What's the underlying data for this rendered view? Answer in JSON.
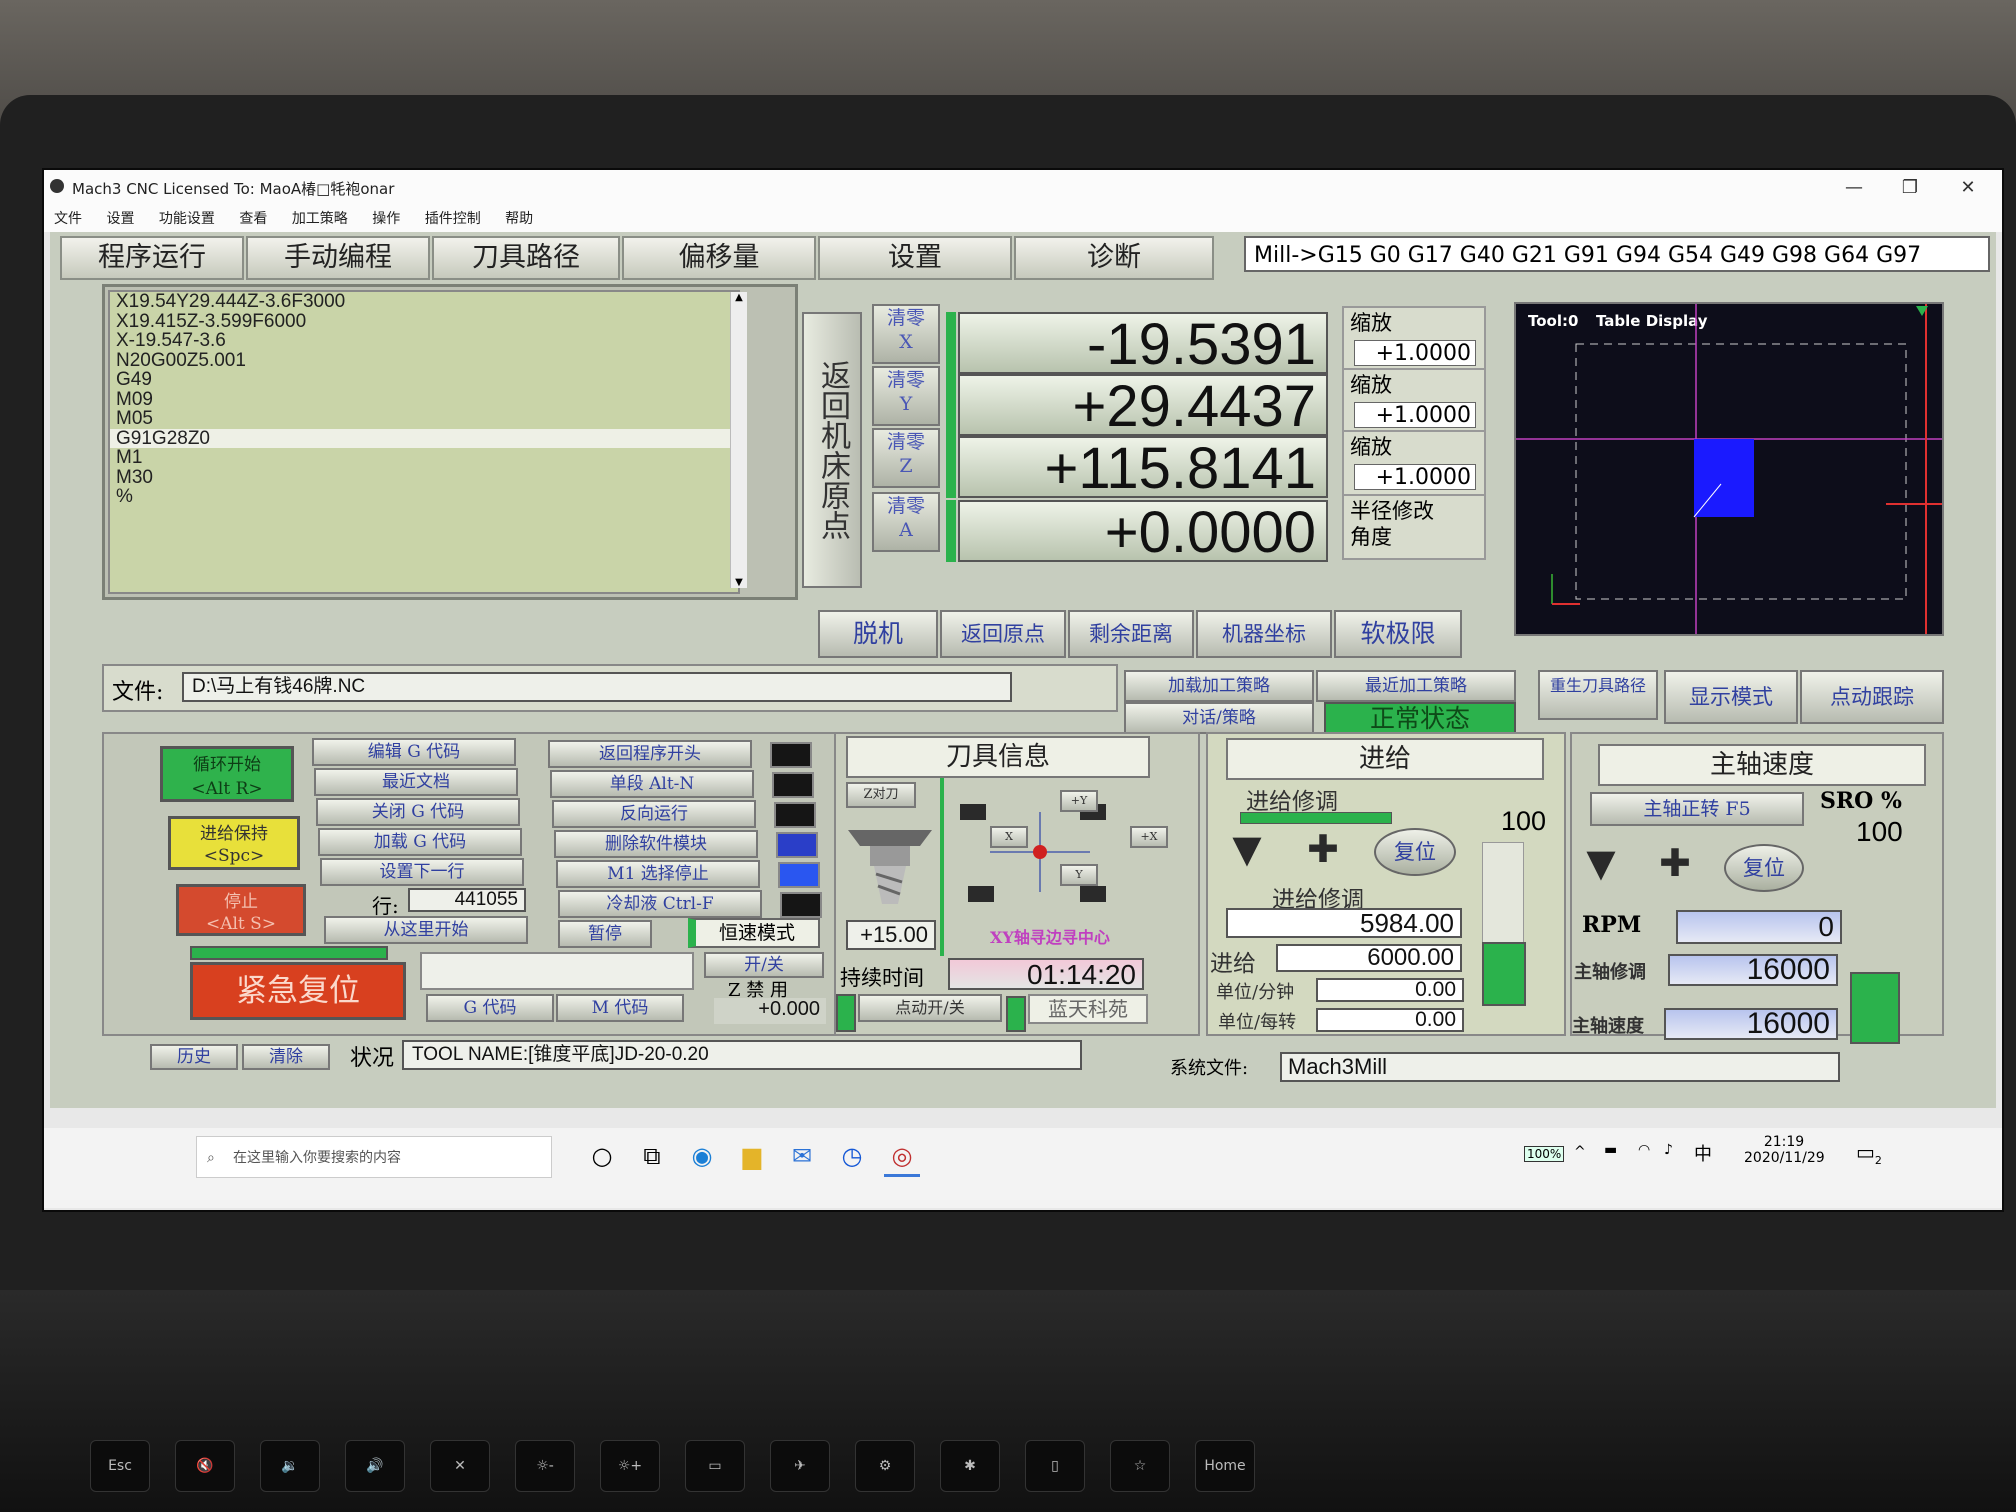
{
  "window": {
    "title": "Mach3 CNC  Licensed To: MaoA椿□牦袍onar",
    "min": "—",
    "restore": "❐",
    "close": "✕"
  },
  "menu": [
    "文件",
    "设置",
    "功能设置",
    "查看",
    "加工策略",
    "操作",
    "插件控制",
    "帮助"
  ],
  "tabs": [
    "程序运行",
    "手动编程",
    "刀具路径",
    "偏移量",
    "设置",
    "诊断"
  ],
  "modal_line": "Mill->G15  G0 G17 G40 G21 G91 G94 G54 G49 G98 G64 G97",
  "gcode": {
    "lines": [
      "X19.54Y29.444Z-3.6F3000",
      "X19.415Z-3.599F6000",
      "X-19.547-3.6",
      "N20G00Z5.001",
      "G49",
      "M09",
      "M05",
      "G91G28Z0",
      "M1",
      "M30",
      "%"
    ],
    "selected_index": 7
  },
  "dro": {
    "ref_all_label": "返回机床原点",
    "axes": [
      {
        "zero": "清零\nX",
        "value": "-19.5391",
        "side_label": "缩放",
        "side_value": "+1.0000"
      },
      {
        "zero": "清零\nY",
        "value": "+29.4437",
        "side_label": "缩放",
        "side_value": "+1.0000"
      },
      {
        "zero": "清零\nZ",
        "value": "+115.8141",
        "side_label": "缩放",
        "side_value": "+1.0000"
      },
      {
        "zero": "清零\nA",
        "value": "+0.0000",
        "side_label": "半径修改\n角度",
        "side_value": ""
      }
    ],
    "buttons": [
      "脱机",
      "返回原点",
      "剩余距离",
      "机器坐标",
      "软极限"
    ]
  },
  "toolpath": {
    "tool": "Tool:0",
    "title": "Table Display"
  },
  "file": {
    "label": "文件:",
    "path": "D:\\马上有钱46牌.NC"
  },
  "strategy": {
    "load": "加载加工策略",
    "recent": "最近加工策略",
    "dialog": "对话/策略",
    "status": "正常状态"
  },
  "right_buttons": [
    "重生刀具路径",
    "显示模式",
    "点动跟踪"
  ],
  "run": {
    "cycle_start": "循环开始\n<Alt R>",
    "feed_hold": "进给保持\n<Spc>",
    "stop": "停止\n<Alt S>",
    "estop": "紧急复位"
  },
  "program_buttons": [
    "编辑 G 代码",
    "最近文档",
    "关闭 G 代码",
    "加载 G 代码",
    "设置下一行"
  ],
  "line": {
    "label": "行:",
    "value": "441055",
    "run_from": "从这里开始"
  },
  "right_program_buttons": [
    "返回程序开头",
    "单段 Alt-N",
    "反向运行",
    "删除软件模块",
    "M1 选择停止",
    "冷却液 Ctrl-F"
  ],
  "pause": "暂停",
  "const_mode": "恒速模式",
  "gcode_btn": "G 代码",
  "mcode_btn": "M 代码",
  "z_inhibit": {
    "on_off": "开/关",
    "label": "Z 禁 用",
    "value": "+0.000"
  },
  "tool_info": {
    "title": "刀具信息",
    "ztouch": "Z对刀",
    "z_value": "+15.00",
    "edge_label": "XY轴寻边寻中心",
    "elapsed_label": "持续时间",
    "elapsed": "01:14:20",
    "jog": "点动开/关",
    "brand": "蓝天科苑",
    "jog_axes": [
      "+Y",
      "X",
      "+X",
      "Y"
    ]
  },
  "feed": {
    "title": "进给",
    "override_label": "进给修调",
    "reset": "复位",
    "override_pct": "100",
    "override2_label": "进给修调",
    "override_value": "5984.00",
    "feed_label": "进给",
    "feed_value": "6000.00",
    "upm_label": "单位/分钟",
    "upm_value": "0.00",
    "upr_label": "单位/每转",
    "upr_value": "0.00"
  },
  "spindle": {
    "title": "主轴速度",
    "toggle": "主轴正转 F5",
    "sro_label": "SRO %",
    "sro_value": "100",
    "reset": "复位",
    "rpm_label": "RPM",
    "rpm_value": "0",
    "override_label": "主轴修调",
    "override_value": "16000",
    "speed_label": "主轴速度",
    "speed_value": "16000"
  },
  "status_bar": {
    "history": "历史",
    "clear": "清除",
    "status_label": "状况",
    "status": "TOOL NAME:[锥度平底]JD-20-0.20",
    "profile_label": "系统文件:",
    "profile": "Mach3Mill"
  },
  "taskbar": {
    "search_placeholder": "在这里输入你要搜索的内容",
    "battery": "100%",
    "ime": "中",
    "time": "21:19",
    "date": "2020/11/29",
    "notif_count": "2"
  },
  "keys": [
    "Esc",
    "🔇",
    "🔉",
    "🔊",
    "✕",
    "☼-",
    "☼+",
    "▭",
    "✈",
    "⚙",
    "✱",
    "▯",
    "☆",
    "Home"
  ]
}
